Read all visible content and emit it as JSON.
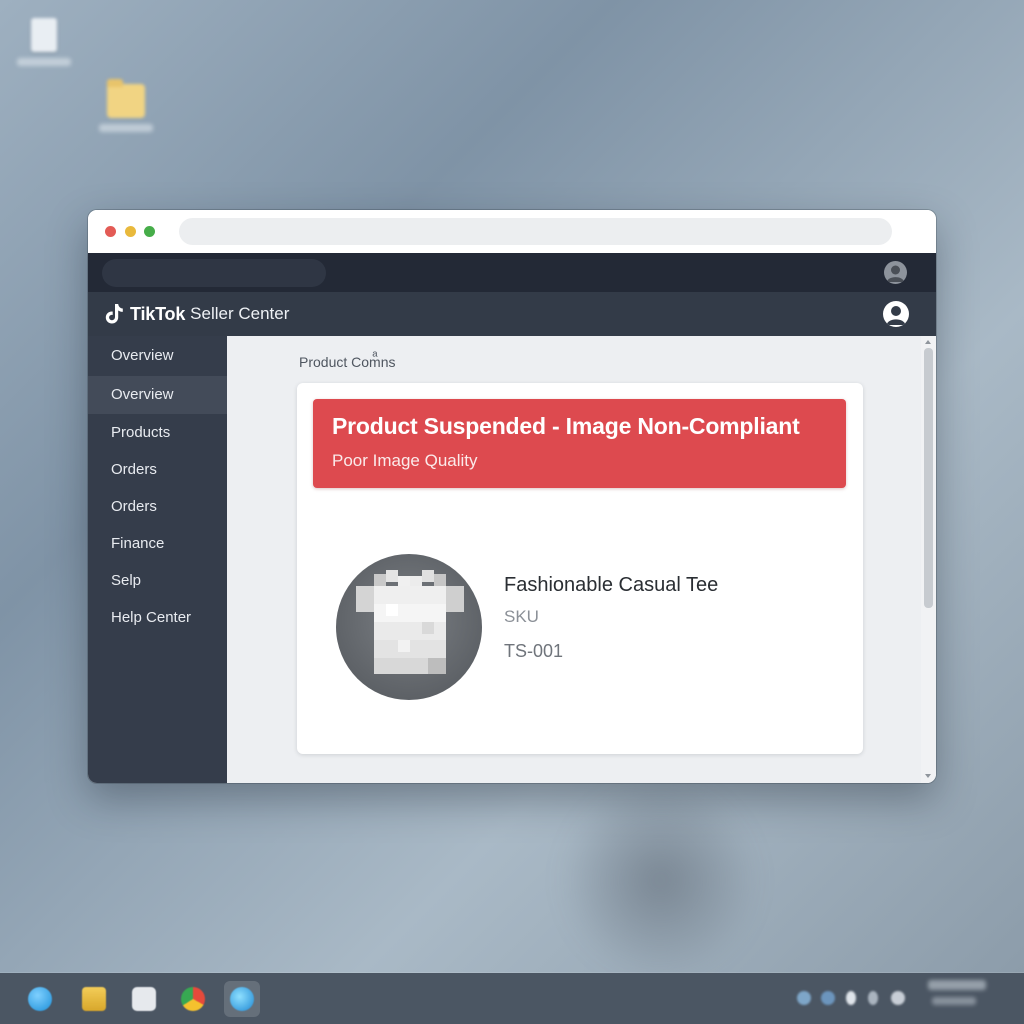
{
  "desktop": {
    "icons": [
      {
        "name": "recycle-bin",
        "label": ""
      },
      {
        "name": "folder",
        "label": ""
      }
    ]
  },
  "browser": {
    "address": "",
    "traffic_lights": [
      "#e35b55",
      "#e9b93c",
      "#46ad49"
    ]
  },
  "app": {
    "brand": {
      "primary": "TikTok",
      "secondary": "Seller Center",
      "icon": "tiktok-logo-icon"
    },
    "header_bg": "#333b48",
    "sidebar_bg": "#353d4b"
  },
  "sidebar": {
    "items": [
      {
        "label": "Overview",
        "active": false
      },
      {
        "label": "Overview",
        "active": true
      },
      {
        "label": "Products",
        "active": false
      },
      {
        "label": "Orders",
        "active": false
      },
      {
        "label": "Orders",
        "active": false
      },
      {
        "label": "Finance",
        "active": false
      },
      {
        "label": "Selp",
        "active": false
      },
      {
        "label": "Help Center",
        "active": false
      }
    ]
  },
  "main": {
    "breadcrumb": "Product Comͣns",
    "alert": {
      "title": "Product Suspended - Image Non-Compliant",
      "subtitle": "Poor Image Quality",
      "color": "#dd4a4f"
    },
    "product": {
      "name": "Fashionable Casual Tee",
      "sku_label": "SKU",
      "sku_value": "TS-001",
      "thumbnail_icon": "tshirt-icon"
    }
  },
  "taskbar": {
    "apps": [
      "browser-globe-icon",
      "file-explorer-icon",
      "store-icon",
      "chrome-icon",
      "edge-icon"
    ],
    "active_app": "edge-icon"
  }
}
